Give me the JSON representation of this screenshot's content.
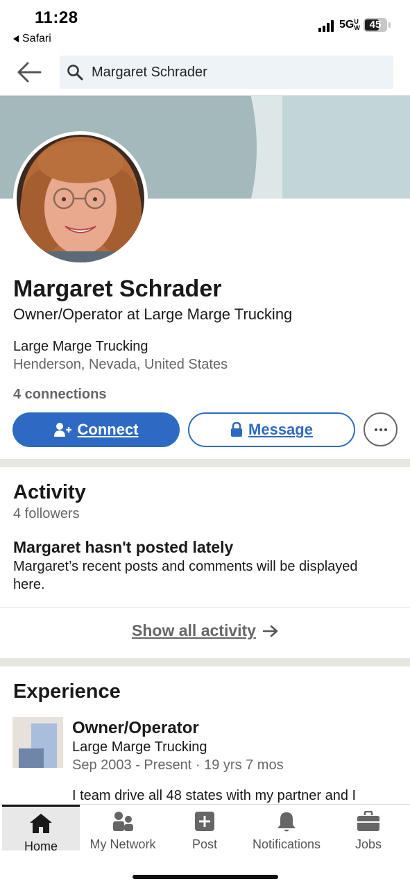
{
  "status_bar": {
    "time": "11:28",
    "back_app": "Safari",
    "network": "5GUW",
    "battery_level": "45"
  },
  "search": {
    "query": "Margaret Schrader",
    "back_icon": "back-arrow-icon",
    "search_icon": "search-icon"
  },
  "profile": {
    "name": "Margaret Schrader",
    "headline": "Owner/Operator at Large Marge Trucking",
    "company": "Large Marge Trucking",
    "location": "Henderson, Nevada, United States",
    "connections": "4 connections",
    "connect_label": "Connect",
    "message_label": "Message"
  },
  "activity": {
    "title": "Activity",
    "followers": "4 followers",
    "empty_heading": "Margaret hasn't posted lately",
    "empty_body": "Margaret’s recent posts and comments will be displayed here.",
    "show_all_label": "Show all activity"
  },
  "experience": {
    "title": "Experience",
    "items": [
      {
        "role": "Owner/Operator",
        "company": "Large Marge Trucking",
        "dates": "Sep 2003 - Present · 19 yrs 7 mos",
        "description": "I team drive all 48 states with my partner and I"
      }
    ]
  },
  "bottom_nav": {
    "items": [
      {
        "label": "Home",
        "icon": "home-icon",
        "active": true
      },
      {
        "label": "My Network",
        "icon": "network-icon",
        "active": false
      },
      {
        "label": "Post",
        "icon": "post-icon",
        "active": false
      },
      {
        "label": "Notifications",
        "icon": "bell-icon",
        "active": false
      },
      {
        "label": "Jobs",
        "icon": "briefcase-icon",
        "active": false
      }
    ]
  },
  "colors": {
    "brand_blue": "#2e6ac4",
    "secondary_text": "#666666",
    "cover": "#a4b9bc",
    "section_separator": "#e8e6e1"
  }
}
